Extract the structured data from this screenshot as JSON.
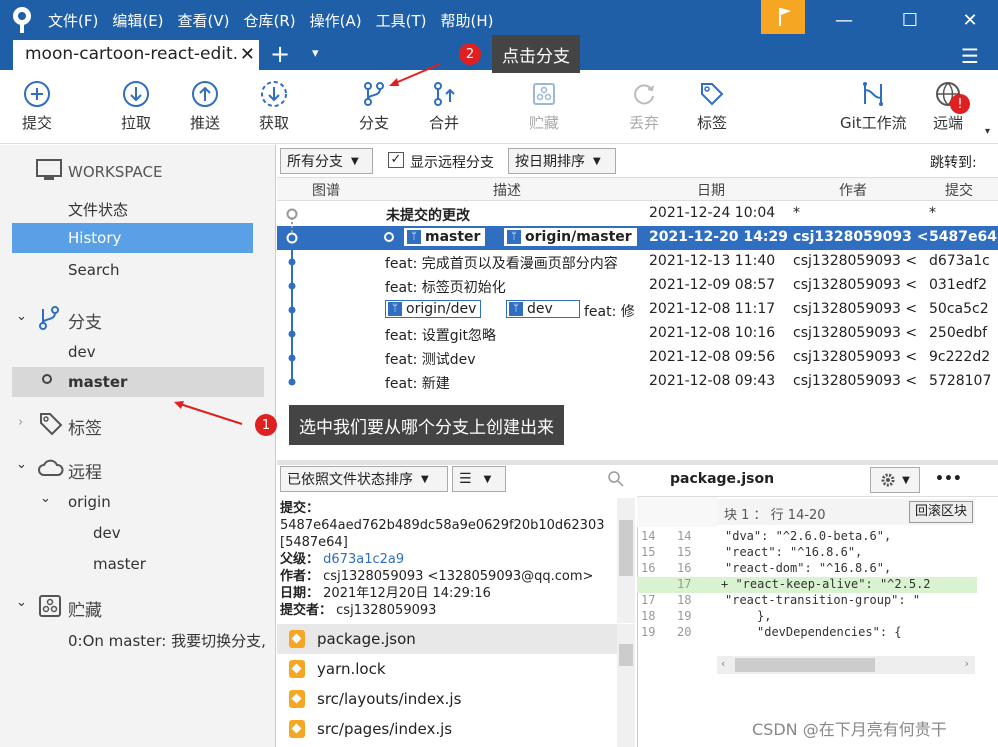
{
  "titlebar": {
    "menus": [
      "文件(F)",
      "编辑(E)",
      "查看(V)",
      "仓库(R)",
      "操作(A)",
      "工具(T)",
      "帮助(H)"
    ],
    "minimize": "—",
    "maximize": "☐",
    "close": "✕"
  },
  "tabs": {
    "active_tab": "moon-cartoon-react-edit.",
    "close": "✕",
    "add": "+",
    "dropdown": "▾"
  },
  "toolbar": {
    "commit": "提交",
    "pull": "拉取",
    "push": "推送",
    "fetch": "获取",
    "branch": "分支",
    "merge": "合并",
    "stash": "贮藏",
    "discard": "丢弃",
    "tag": "标签",
    "gitflow": "Git工作流",
    "remote": "远端",
    "remote_badge": "!"
  },
  "callouts": {
    "step2_num": "2",
    "step2_text": "点击分支",
    "step1_num": "1",
    "step1_text": "选中我们要从哪个分支上创建出来"
  },
  "sidebar": {
    "workspace": "WORKSPACE",
    "file_status": "文件状态",
    "history": "History",
    "search": "Search",
    "branches": "分支",
    "branch_dev": "dev",
    "branch_master": "master",
    "tags": "标签",
    "remotes": "远程",
    "origin": "origin",
    "origin_dev": "dev",
    "origin_master": "master",
    "stashes": "贮藏",
    "stash_item": "0:On master: 我要切换分支,"
  },
  "historybar": {
    "all_branches": "所有分支",
    "show_remote": "显示远程分支",
    "sort_date": "按日期排序",
    "jump_to": "跳转到:"
  },
  "columns": {
    "graph": "图谱",
    "desc": "描述",
    "date": "日期",
    "author": "作者",
    "commit": "提交"
  },
  "commits": [
    {
      "desc": "未提交的更改",
      "date": "2021-12-24 10:04",
      "author": "*",
      "hash": "*"
    },
    {
      "ref1": "master",
      "ref2": "origin/master",
      "date": "2021-12-20 14:29",
      "author": "csj1328059093 <",
      "hash": "5487e64"
    },
    {
      "desc": "feat: 完成首页以及看漫画页部分内容",
      "date": "2021-12-13 11:40",
      "author": "csj1328059093 <",
      "hash": "d673a1c"
    },
    {
      "desc": "feat: 标签页初始化",
      "date": "2021-12-09 08:57",
      "author": "csj1328059093 <",
      "hash": "031edf2"
    },
    {
      "ref1": "origin/dev",
      "ref2": "dev",
      "desc": "feat: 修",
      "date": "2021-12-08 11:17",
      "author": "csj1328059093 <",
      "hash": "50ca5c2"
    },
    {
      "desc": "feat: 设置git忽略",
      "date": "2021-12-08 10:16",
      "author": "csj1328059093 <",
      "hash": "250edbf"
    },
    {
      "desc": "feat: 测试dev",
      "date": "2021-12-08 09:56",
      "author": "csj1328059093 <",
      "hash": "9c222d2"
    },
    {
      "desc": "feat: 新建",
      "date": "2021-12-08 09:43",
      "author": "csj1328059093 <",
      "hash": "5728107"
    }
  ],
  "details": {
    "sort_by_status": "已依照文件状态排序",
    "list_icon": "☰",
    "commit_label": "提交：",
    "commit_hash": "5487e64aed762b489dc58a9e0629f20b10d62303 [5487e64]",
    "parent_label": "父级：",
    "parent_value": "d673a1c2a9",
    "author_label": "作者：",
    "author_value": "csj1328059093 <1328059093@qq.com>",
    "date_label": "日期：",
    "date_value": "2021年12月20日 14:29:16",
    "committer_label": "提交者：",
    "committer_value": "csj1328059093"
  },
  "files": [
    "package.json",
    "yarn.lock",
    "src/layouts/index.js",
    "src/pages/index.js"
  ],
  "diff": {
    "filename": "package.json",
    "more": "•••",
    "hunk": "块 1 ： 行 14-20",
    "revert_hunk": "回滚区块",
    "lines": [
      {
        "n1": "14",
        "n2": "14",
        "code": "\"dva\": \"^2.6.0-beta.6\","
      },
      {
        "n1": "15",
        "n2": "15",
        "code": "\"react\": \"^16.8.6\","
      },
      {
        "n1": "16",
        "n2": "16",
        "code": "\"react-dom\": \"^16.8.6\","
      },
      {
        "n1": "",
        "n2": "17",
        "code": "+ \"react-keep-alive\": \"^2.5.2"
      },
      {
        "n1": "17",
        "n2": "18",
        "code": "\"react-transition-group\": \""
      },
      {
        "n1": "18",
        "n2": "19",
        "code": "},"
      },
      {
        "n1": "19",
        "n2": "20",
        "code": "\"devDependencies\": {"
      }
    ]
  },
  "watermark": "CSDN @在下月亮有何贵干"
}
